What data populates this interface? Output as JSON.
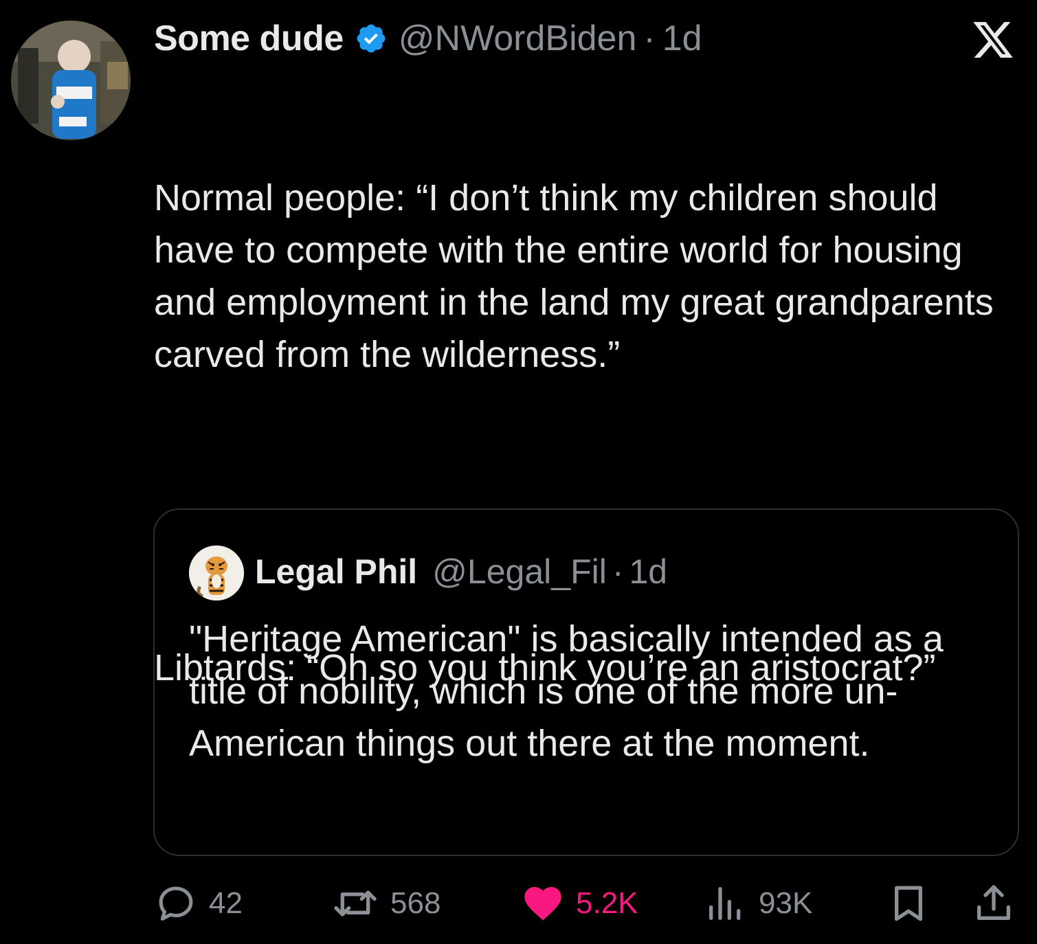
{
  "tweet": {
    "author": {
      "display_name": "Some dude",
      "handle": "@NWordBiden",
      "time": "1d",
      "separator": "·"
    },
    "paragraphs": [
      "Normal people: “I don’t think my children should have to compete with the entire world for housing and employment in the land my great grandparents carved from the wilderness.”",
      "Libtards: “Oh so you think you’re an aristocrat?”"
    ]
  },
  "quoted_tweet": {
    "author": {
      "display_name": "Legal Phil",
      "handle": "@Legal_Fil",
      "time": "1d",
      "separator": "·"
    },
    "text": "\"Heritage American\" is basically intended as a title of nobility, which is one of the more un-American things out there at the moment."
  },
  "actions": {
    "replies": "42",
    "reposts": "568",
    "likes": "5.2K",
    "views": "93K"
  },
  "icons": {
    "app_logo": "x-logo-icon",
    "verified": "verified-badge-icon",
    "reply": "reply-icon",
    "repost": "repost-icon",
    "like": "heart-icon",
    "views": "views-chart-icon",
    "bookmark": "bookmark-icon",
    "share": "share-icon"
  },
  "colors": {
    "background": "#000000",
    "text_primary": "#e7e9ea",
    "text_secondary": "#8b9096",
    "verified_blue": "#1d9bf0",
    "like_pink": "#f91880",
    "border": "#2b2f33"
  }
}
